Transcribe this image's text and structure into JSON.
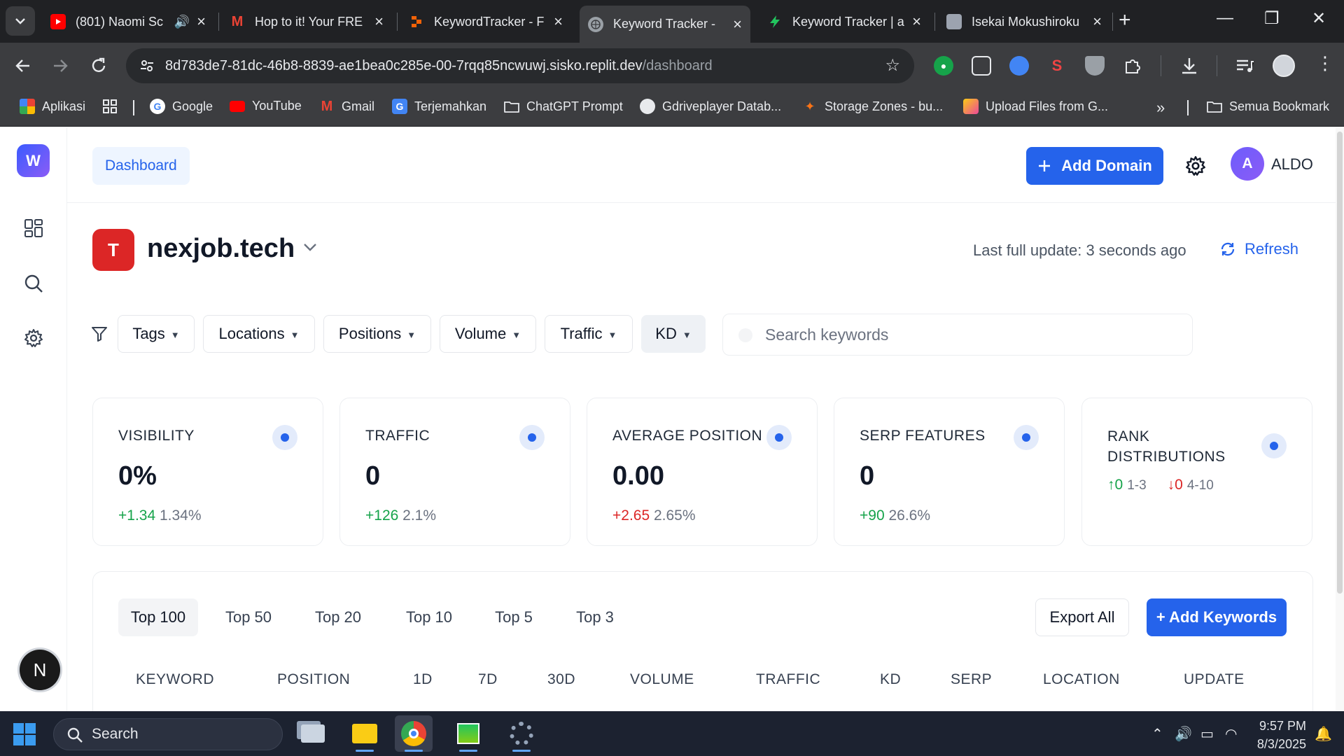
{
  "browser": {
    "tabs": [
      {
        "title": "(801) Naomi Sc",
        "favicon": "youtube-icon",
        "audio": true
      },
      {
        "title": "Hop to it! Your FRE",
        "favicon": "gmail-icon"
      },
      {
        "title": "KeywordTracker - F",
        "favicon": "replit-icon"
      },
      {
        "title": "Keyword Tracker - ",
        "favicon": "globe-icon",
        "active": true
      },
      {
        "title": "Keyword Tracker | a",
        "favicon": "bolt-icon"
      },
      {
        "title": "Isekai Mokushiroku",
        "favicon": "anime-icon"
      }
    ],
    "url_host": "8d783de7-81dc-46b8-8839-ae1bea0c285e-00-7rqq85ncwuwj.sisko.replit.dev",
    "url_path": "/dashboard",
    "bookmarks": [
      {
        "label": "Aplikasi",
        "icon": "apps-grid-icon"
      },
      {
        "label": "Google",
        "icon": "google-icon"
      },
      {
        "label": "YouTube",
        "icon": "youtube-icon"
      },
      {
        "label": "Gmail",
        "icon": "gmail-icon"
      },
      {
        "label": "Terjemahkan",
        "icon": "translate-icon"
      },
      {
        "label": "ChatGPT Prompt",
        "icon": "folder-icon"
      },
      {
        "label": "Gdriveplayer Datab...",
        "icon": "globe-icon"
      },
      {
        "label": "Storage Zones - bu...",
        "icon": "bunny-icon"
      },
      {
        "label": "Upload Files from G...",
        "icon": "cube-icon"
      },
      {
        "label": "Semua Bookmark",
        "icon": "folder-icon"
      }
    ]
  },
  "app": {
    "logo_letter": "W",
    "breadcrumb": "Dashboard",
    "add_domain_label": "Add Domain",
    "user": {
      "initial": "A",
      "name": "ALDO"
    },
    "domain": {
      "badge": "T",
      "name": "nexjob.tech"
    },
    "last_update": "Last full update: 3 seconds ago",
    "refresh_label": "Refresh",
    "filters": [
      "Tags",
      "Locations",
      "Positions",
      "Volume",
      "Traffic",
      "KD"
    ],
    "active_filter": "KD",
    "search_placeholder": "Search keywords",
    "cards": [
      {
        "title": "VISIBILITY",
        "value": "0%",
        "delta": "+1.34",
        "delta_dir": "up",
        "pct": "1.34%"
      },
      {
        "title": "TRAFFIC",
        "value": "0",
        "delta": "+126",
        "delta_dir": "up",
        "pct": "2.1%"
      },
      {
        "title": "AVERAGE POSITION",
        "value": "0.00",
        "delta": "+2.65",
        "delta_dir": "down",
        "pct": "2.65%"
      },
      {
        "title": "SERP FEATURES",
        "value": "0",
        "delta": "+90",
        "delta_dir": "up",
        "pct": "26.6%"
      }
    ],
    "rank_card": {
      "title": "RANK DISTRIBUTIONS",
      "items": [
        {
          "arrow": "↑",
          "value": "0",
          "label": "1-3",
          "dir": "up"
        },
        {
          "arrow": "↓",
          "value": "0",
          "label": "4-10",
          "dir": "down"
        }
      ]
    },
    "range_tabs": [
      "Top 100",
      "Top 50",
      "Top 20",
      "Top 10",
      "Top 5",
      "Top 3"
    ],
    "active_range": "Top 100",
    "export_label": "Export All",
    "add_keywords_label": "+ Add Keywords",
    "columns": [
      "KEYWORD",
      "POSITION",
      "1D",
      "7D",
      "30D",
      "VOLUME",
      "TRAFFIC",
      "KD",
      "SERP",
      "LOCATION",
      "UPDATE"
    ],
    "accent": "#2563eb"
  },
  "taskbar": {
    "search_label": "Search",
    "time": "9:57 PM",
    "date": "8/3/2025"
  }
}
